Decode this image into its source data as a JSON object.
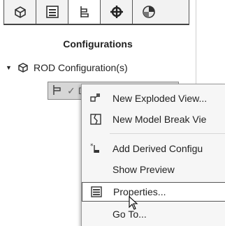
{
  "tabs": [
    {
      "name": "feature-manager-tab",
      "icon": "feature-tree-icon"
    },
    {
      "name": "property-manager-tab",
      "icon": "property-manager-icon"
    },
    {
      "name": "configuration-manager-tab",
      "icon": "configuration-manager-icon",
      "active": true
    },
    {
      "name": "dimxpert-manager-tab",
      "icon": "dimxpert-icon"
    },
    {
      "name": "display-manager-tab",
      "icon": "display-manager-icon"
    }
  ],
  "panel": {
    "title": "Configurations",
    "root": {
      "label": "ROD Configuration(s)",
      "expanded": true
    },
    "selected_config": {
      "label": "D"
    }
  },
  "context_menu": {
    "items": [
      {
        "label": "New Exploded View...",
        "icon": "exploded-view-icon"
      },
      {
        "label": "New Model Break Vie",
        "icon": "model-break-view-icon"
      },
      {
        "label": "Add Derived Configu",
        "icon": "derived-configuration-icon"
      },
      {
        "label": "Show Preview",
        "icon": ""
      },
      {
        "label": "Properties...",
        "icon": "properties-icon",
        "highlighted": true
      },
      {
        "label": "Go To...",
        "icon": ""
      }
    ]
  },
  "colors": {
    "selected_row_bg": "#d6d6d6",
    "menu_bg": "#f6f6f6",
    "highlight_bg": "#ffffff"
  }
}
